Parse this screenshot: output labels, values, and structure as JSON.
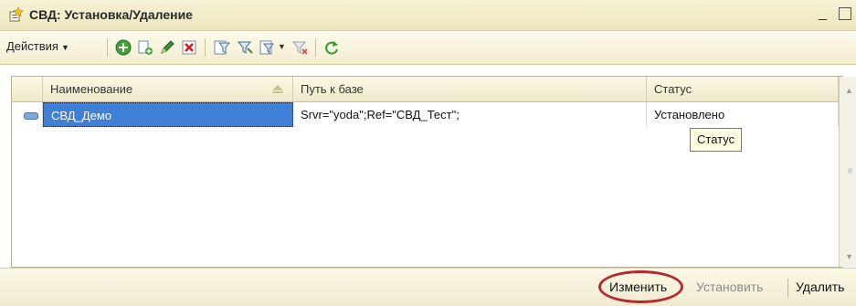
{
  "window": {
    "title": "СВД: Установка/Удаление"
  },
  "toolbar": {
    "actions_label": "Действия",
    "buttons": [
      {
        "icon": "add-icon"
      },
      {
        "icon": "copy-icon"
      },
      {
        "icon": "edit-pencil-icon"
      },
      {
        "icon": "delete-icon"
      },
      {
        "icon": "filter-settings-icon"
      },
      {
        "icon": "filter-by-value-icon"
      },
      {
        "icon": "filter-history-icon"
      },
      {
        "icon": "clear-filter-icon"
      },
      {
        "icon": "refresh-icon"
      }
    ]
  },
  "table": {
    "columns": [
      "Наименование",
      "Путь к базе",
      "Статус"
    ],
    "rows": [
      {
        "name": "СВД_Демо",
        "path": "Srvr=\"yoda\";Ref=\"СВД_Тест\";",
        "status": "Установлено"
      }
    ]
  },
  "tooltip": {
    "text": "Статус"
  },
  "bottom_buttons": {
    "change": "Изменить",
    "install": "Установить",
    "remove": "Удалить"
  },
  "colors": {
    "selection": "#3f7fd8",
    "highlight_ring": "#b5292f",
    "panel": "#f2ecd0"
  }
}
